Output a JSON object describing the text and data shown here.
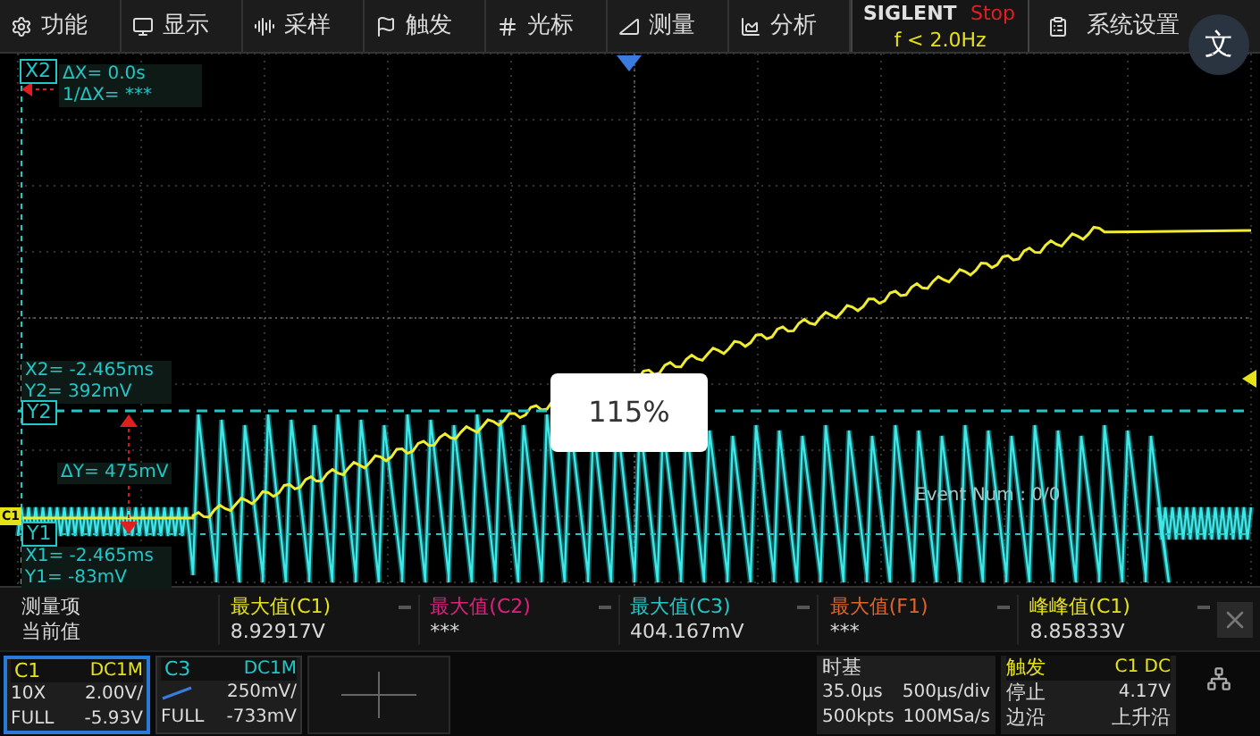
{
  "menu": [
    {
      "label": "功能"
    },
    {
      "label": "显示"
    },
    {
      "label": "采样"
    },
    {
      "label": "触发"
    },
    {
      "label": "光标"
    },
    {
      "label": "测量"
    },
    {
      "label": "分析"
    }
  ],
  "brand": {
    "logo": "SIGLENT",
    "run_state": "Stop",
    "frequency": "f < 2.0Hz"
  },
  "system_menu": {
    "label": "系统设置"
  },
  "translate_button": {
    "glyph": "文"
  },
  "screen": {
    "x2_marker": "X2",
    "y2_marker": "Y2",
    "y1_marker": "Y1",
    "channel_marker": "C1",
    "delta_x": "ΔX= 0.0s",
    "inverse_delta_x": "1/ΔX= ***",
    "x2_readout": "X2= -2.465ms",
    "y2_readout": "Y2= 392mV",
    "delta_y": "ΔY= 475mV",
    "x1_readout": "X1= -2.465ms",
    "y1_readout": "Y1= -83mV",
    "event_num": "Event Num : 0/0",
    "zoom_popup": "115%"
  },
  "measurements": {
    "header_label": "测量项",
    "row_label": "当前值",
    "columns": [
      {
        "name": "最大值(C1)",
        "value": "8.92917V",
        "color": "#e6e21a"
      },
      {
        "name": "最大值(C2)",
        "value": "***",
        "color": "#e0207e"
      },
      {
        "name": "最大值(C3)",
        "value": "404.167mV",
        "color": "#22c8c8"
      },
      {
        "name": "最大值(F1)",
        "value": "***",
        "color": "#e0642a"
      },
      {
        "name": "峰峰值(C1)",
        "value": "8.85833V",
        "color": "#e6e21a"
      }
    ]
  },
  "channels": [
    {
      "name": "C1",
      "coupling": "DC1M",
      "probe": "10X",
      "scale": "2.00V/",
      "bandwidth": "FULL",
      "offset": "-5.93V",
      "selected": true,
      "color": "#e6e21a"
    },
    {
      "name": "C3",
      "coupling": "DC1M",
      "scale": "250mV/",
      "bandwidth": "FULL",
      "offset": "-733mV",
      "selected": false,
      "color": "#22c8c8"
    }
  ],
  "timebase": {
    "title": "时基",
    "delay": "35.0µs",
    "scale": "500µs/div",
    "memory_depth": "500kpts",
    "sample_rate": "100MSa/s"
  },
  "trigger": {
    "title": "触发",
    "source": "C1 DC",
    "state": "停止",
    "level": "4.17V",
    "type": "边沿",
    "slope": "上升沿"
  }
}
